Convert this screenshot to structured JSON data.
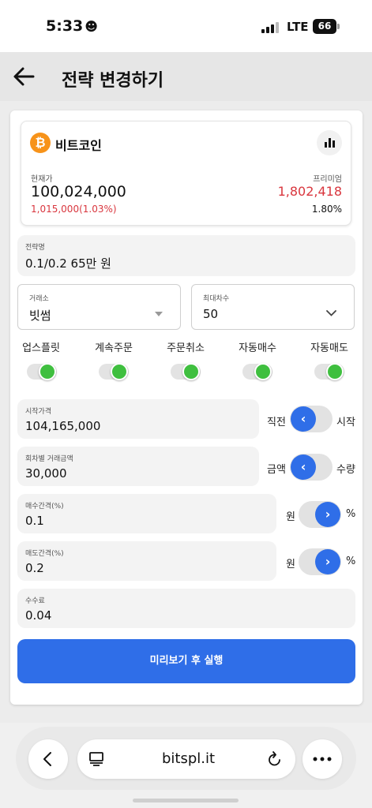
{
  "status_bar": {
    "time": "5:33",
    "emoji": "☻",
    "network": "LTE",
    "battery": "66"
  },
  "header": {
    "title": "전략 변경하기"
  },
  "coin": {
    "name": "비트코인",
    "logo_symbol": "₿",
    "logo_color": "#f7931a",
    "current_price_label": "현재가",
    "current_price": "100,024,000",
    "change": "1,015,000(1.03%)",
    "premium_label": "프리미엄",
    "premium": "1,802,418",
    "premium_pct": "1.80%"
  },
  "strategy": {
    "label": "전략명",
    "value": "0.1/0.2 65만 원"
  },
  "exchange": {
    "label": "거래소",
    "value": "빗썸"
  },
  "max_rounds": {
    "label": "최대차수",
    "value": "50"
  },
  "toggles": [
    {
      "label": "업스플릿",
      "on": true
    },
    {
      "label": "계속주문",
      "on": true
    },
    {
      "label": "주문취소",
      "on": true
    },
    {
      "label": "자동매수",
      "on": true
    },
    {
      "label": "자동매도",
      "on": true
    }
  ],
  "start_price": {
    "label": "시작가격",
    "value": "104,165,000",
    "left": "직전",
    "right": "시작"
  },
  "trade_amount": {
    "label": "회차별 거래금액",
    "value": "30,000",
    "left": "금액",
    "right": "수량"
  },
  "buy_interval": {
    "label": "매수간격(%)",
    "value": "0.1",
    "left": "원",
    "right": "%"
  },
  "sell_interval": {
    "label": "매도간격(%)",
    "value": "0.2",
    "left": "원",
    "right": "%"
  },
  "fee": {
    "label": "수수료",
    "value": "0.04"
  },
  "submit": {
    "label": "미리보기 후 실행"
  },
  "browser": {
    "url": "bitspl.it"
  },
  "colors": {
    "accent": "#2f6ee8",
    "toggle_on": "#3fbf3f",
    "negative": "#d9363e"
  }
}
